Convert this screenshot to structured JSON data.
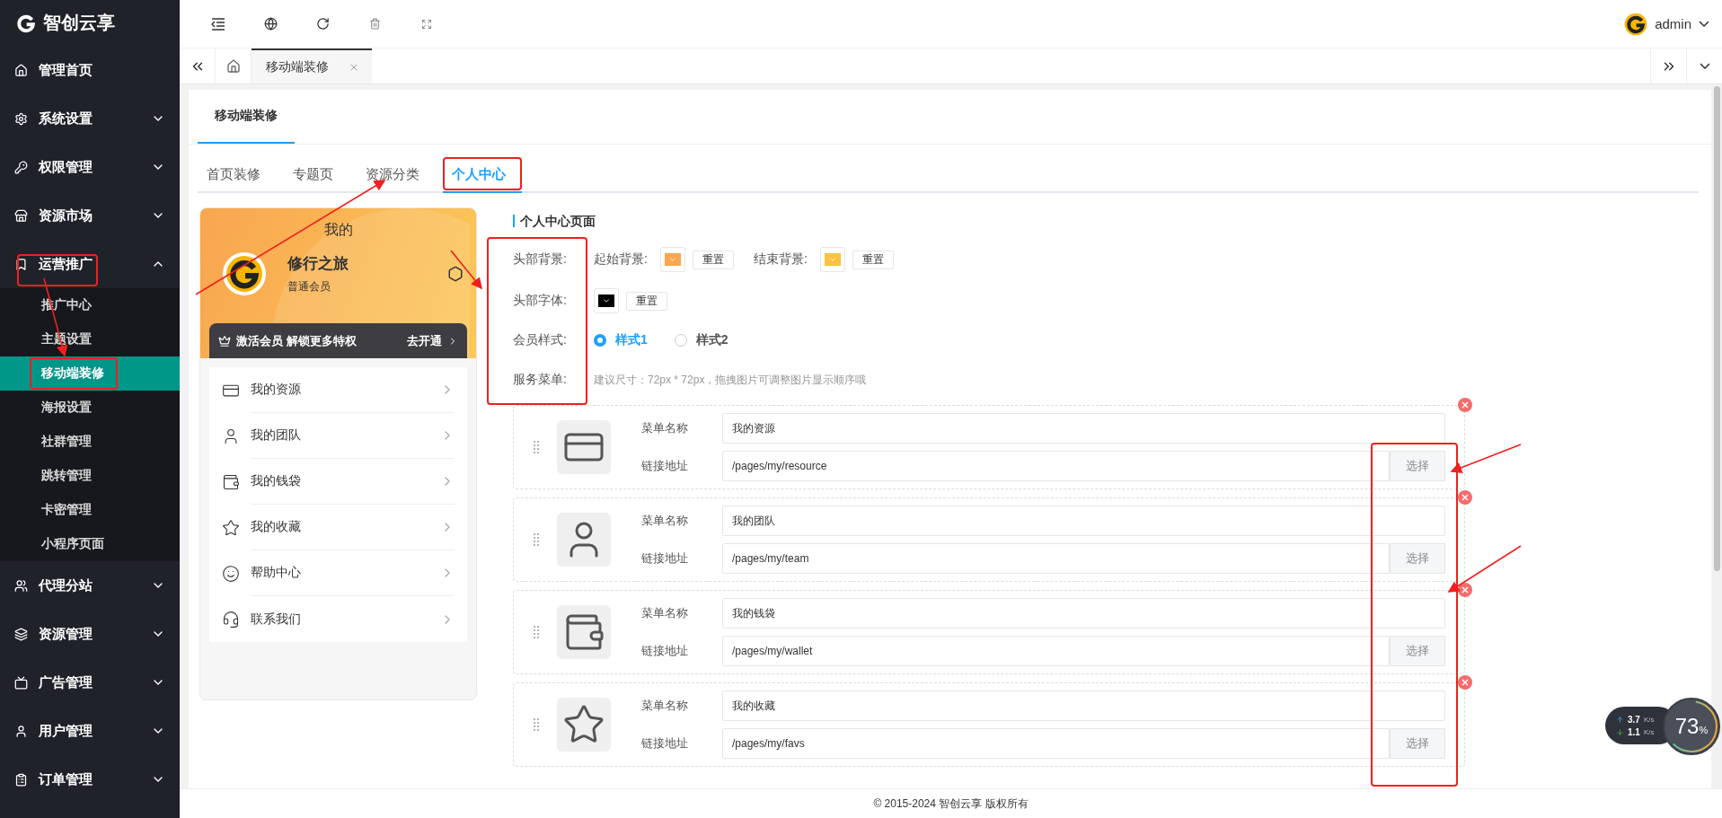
{
  "sidebar": {
    "logo": "智创云享",
    "items": [
      {
        "label": "管理首页",
        "kind": "link"
      },
      {
        "label": "系统设置",
        "kind": "group",
        "expanded": false
      },
      {
        "label": "权限管理",
        "kind": "group",
        "expanded": false
      },
      {
        "label": "资源市场",
        "kind": "group",
        "expanded": false
      },
      {
        "label": "运营推广",
        "kind": "group",
        "expanded": true,
        "children": [
          {
            "label": "推广中心",
            "selected": false
          },
          {
            "label": "主题设置",
            "selected": false
          },
          {
            "label": "移动端装修",
            "selected": true
          },
          {
            "label": "海报设置",
            "selected": false
          },
          {
            "label": "社群管理",
            "selected": false
          },
          {
            "label": "跳转管理",
            "selected": false
          },
          {
            "label": "卡密管理",
            "selected": false
          },
          {
            "label": "小程序页面",
            "selected": false
          }
        ]
      },
      {
        "label": "代理分站",
        "kind": "group",
        "expanded": false
      },
      {
        "label": "资源管理",
        "kind": "group",
        "expanded": false
      },
      {
        "label": "广告管理",
        "kind": "group",
        "expanded": false
      },
      {
        "label": "用户管理",
        "kind": "group",
        "expanded": false
      },
      {
        "label": "订单管理",
        "kind": "group",
        "expanded": false
      }
    ]
  },
  "header": {
    "user": "admin"
  },
  "tab_bar": {
    "tabs": [
      {
        "label": "移动端装修",
        "selected": true
      }
    ]
  },
  "page": {
    "title": "移动端装修",
    "tabs": [
      {
        "label": "首页装修",
        "selected": false
      },
      {
        "label": "专题页",
        "selected": false
      },
      {
        "label": "资源分类",
        "selected": false
      },
      {
        "label": "个人中心",
        "selected": true
      }
    ],
    "preview": {
      "title": "我的",
      "name": "修行之旅",
      "level": "普通会员",
      "vip_text": "激活会员 解锁更多特权",
      "vip_action": "去开通",
      "items": [
        "我的资源",
        "我的团队",
        "我的钱袋",
        "我的收藏",
        "帮助中心",
        "联系我们"
      ]
    },
    "form": {
      "section_title": "个人中心页面",
      "header_bg": {
        "label": "头部背景:",
        "start_label": "起始背景:",
        "end_label": "结束背景:",
        "reset": "重置",
        "reset_2": "重置"
      },
      "header_font": {
        "label": "头部字体:",
        "reset": "重置"
      },
      "member_style": {
        "label": "会员样式:",
        "options": [
          {
            "label": "样式1",
            "selected": true
          },
          {
            "label": "样式2",
            "selected": false
          }
        ]
      },
      "service_menu": {
        "label": "服务菜单:",
        "hint": "建议尺寸：72px * 72px，拖拽图片可调整图片显示顺序哦"
      },
      "menus": [
        {
          "name_label": "菜单名称",
          "name": "我的资源",
          "link_label": "链接地址",
          "link": "/pages/my/resource",
          "button": "选择"
        },
        {
          "name_label": "菜单名称",
          "name": "我的团队",
          "link_label": "链接地址",
          "link": "/pages/my/team",
          "button": "选择"
        },
        {
          "name_label": "菜单名称",
          "name": "我的钱袋",
          "link_label": "链接地址",
          "link": "/pages/my/wallet",
          "button": "选择"
        },
        {
          "name_label": "菜单名称",
          "name": "我的收藏",
          "link_label": "链接地址",
          "link": "/pages/my/favs",
          "button": "选择"
        }
      ]
    }
  },
  "footer": "© 2015-2024 智创云享 版权所有",
  "speed_widget": {
    "upload": "3.7",
    "download": "1.1",
    "unit": "K/s",
    "unit_2": "K/s",
    "percent": "73",
    "percent_sign": "%"
  }
}
